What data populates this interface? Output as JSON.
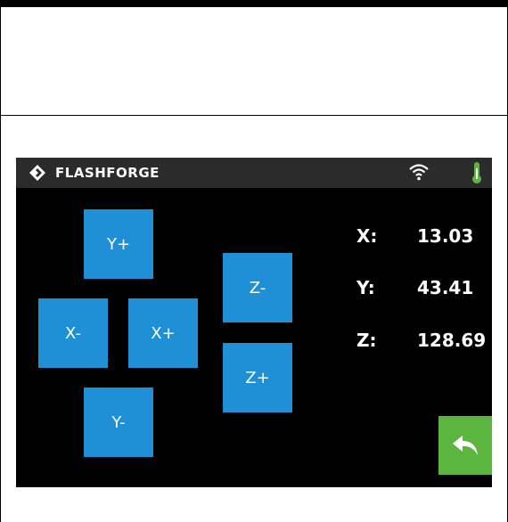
{
  "brand": "FLASHFORGE",
  "jog_buttons": {
    "y_plus": "Y+",
    "y_minus": "Y-",
    "x_minus": "X-",
    "x_plus": "X+",
    "z_minus": "Z-",
    "z_plus": "Z+"
  },
  "position": {
    "x_label": "X:",
    "x_value": "13.03",
    "y_label": "Y:",
    "y_value": "43.41",
    "z_label": "Z:",
    "z_value": "128.69"
  },
  "icons": {
    "logo": "flashforge-logo-icon",
    "wifi": "wifi-icon",
    "temperature": "thermometer-icon",
    "back": "back-arrow-icon"
  },
  "colors": {
    "button_blue": "#1f8fd6",
    "back_green": "#5cb53e",
    "status_bar": "#2b2b2b",
    "thermometer": "#5cb53e"
  }
}
